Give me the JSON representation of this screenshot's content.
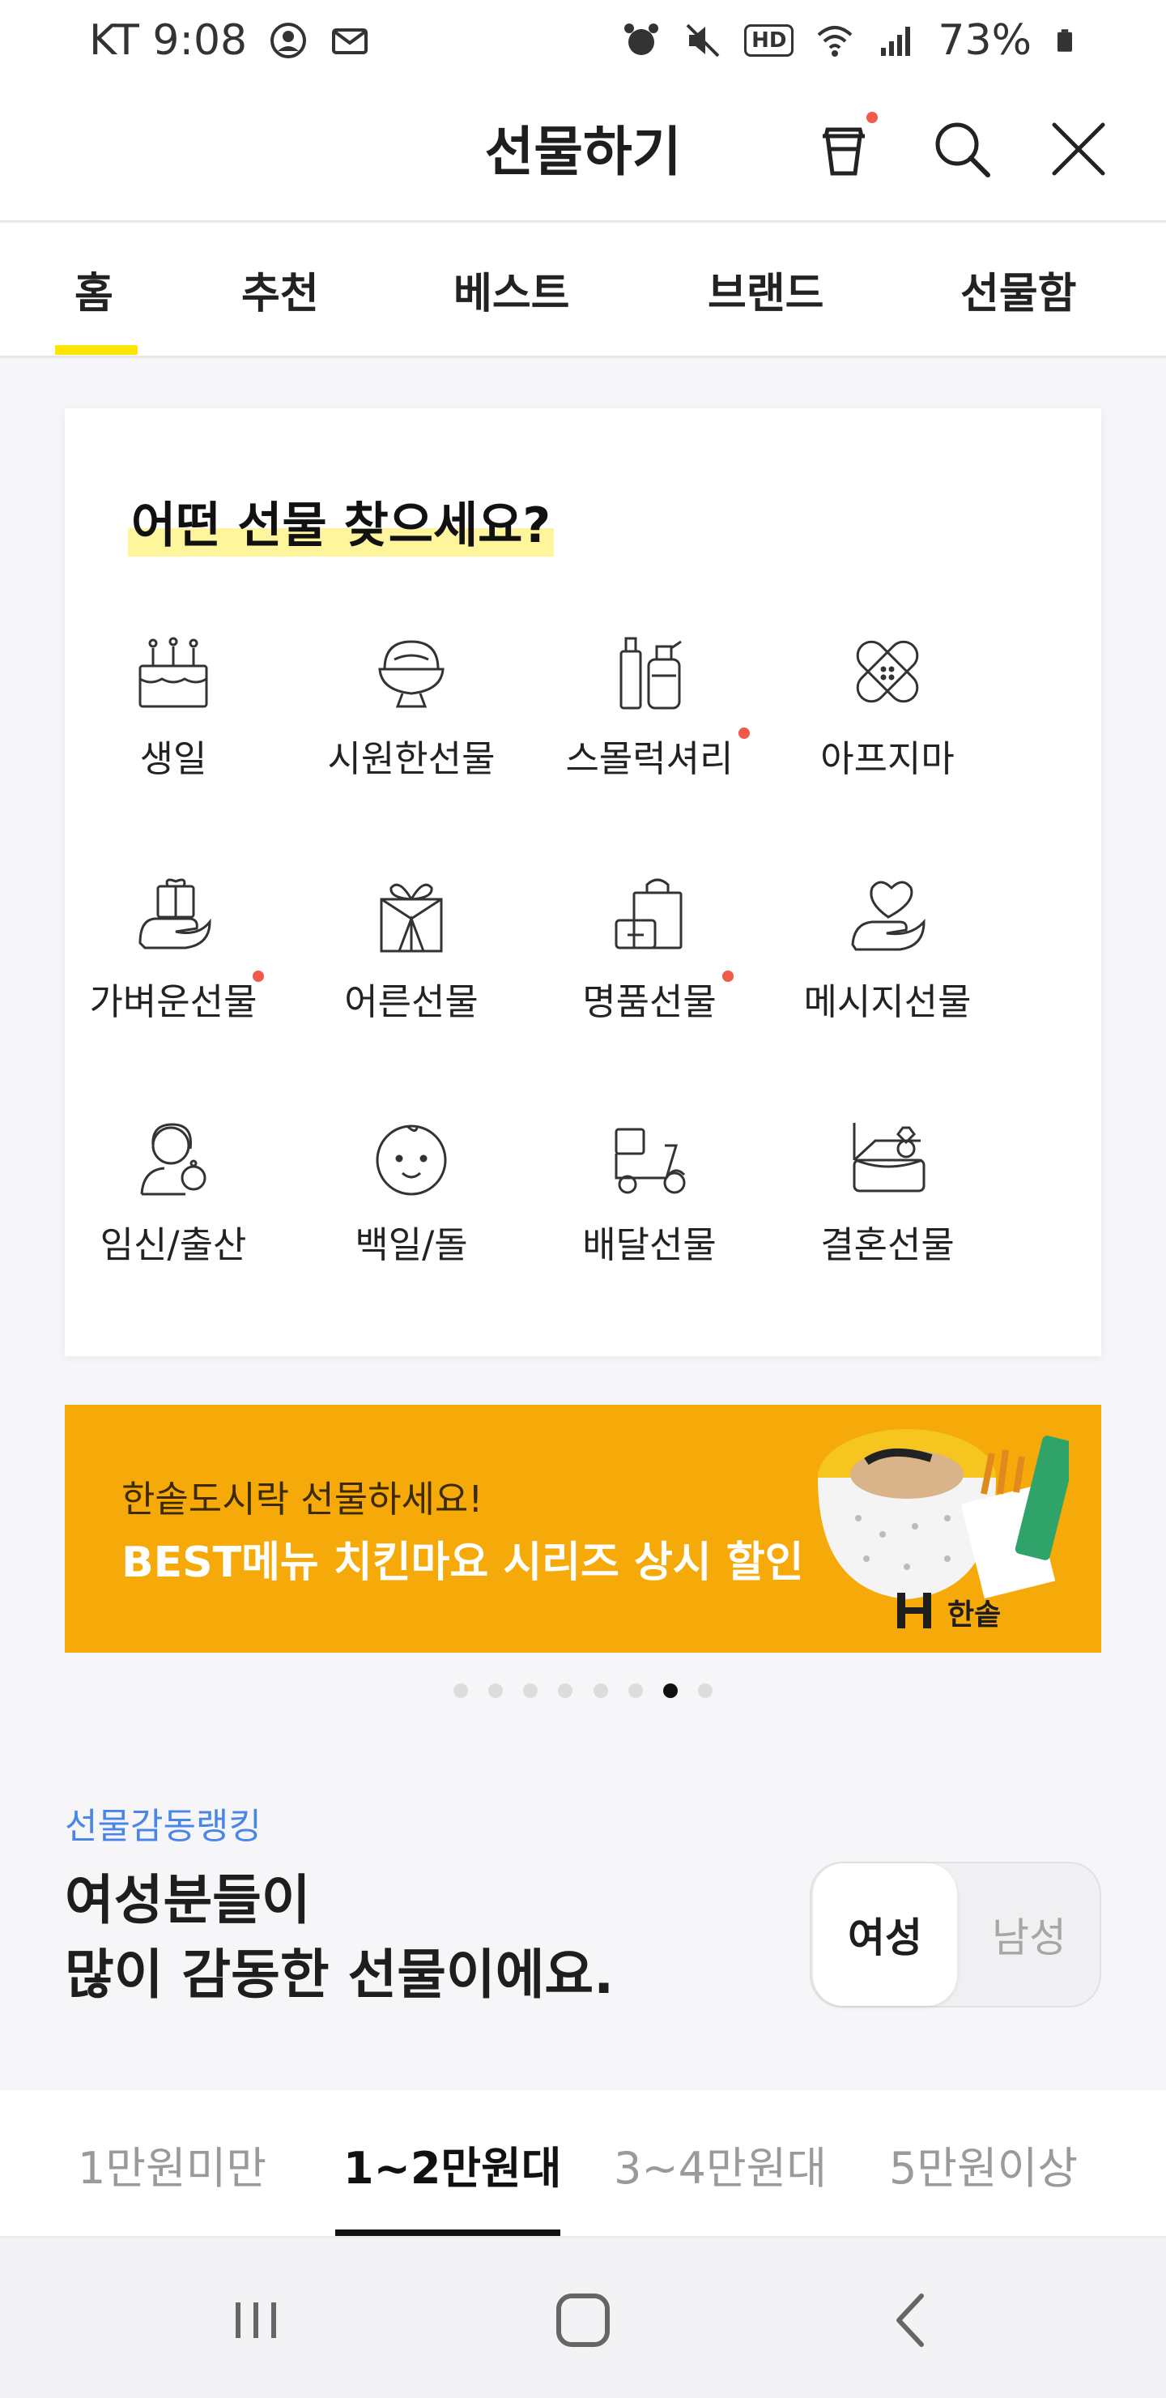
{
  "status_bar": {
    "carrier_time": "KT 9:08",
    "hd_label": "HD",
    "battery": "73%"
  },
  "header": {
    "title": "선물하기"
  },
  "main_tabs": [
    {
      "label": "홈"
    },
    {
      "label": "추천"
    },
    {
      "label": "베스트"
    },
    {
      "label": "브랜드"
    },
    {
      "label": "선물함"
    }
  ],
  "category_card": {
    "heading": "어떤 선물 찾으세요?",
    "items": [
      {
        "label": "생일",
        "icon": "birthday-cake-icon"
      },
      {
        "label": "시원한선물",
        "icon": "shaved-ice-icon"
      },
      {
        "label": "스몰럭셔리",
        "icon": "cosmetics-bottles-icon"
      },
      {
        "label": "아프지마",
        "icon": "bandage-icon"
      },
      {
        "label": "가벼운선물",
        "icon": "gift-in-hand-icon"
      },
      {
        "label": "어른선물",
        "icon": "wrapped-gift-icon"
      },
      {
        "label": "명품선물",
        "icon": "shopping-bag-icon"
      },
      {
        "label": "메시지선물",
        "icon": "heart-in-hand-icon"
      },
      {
        "label": "임신/출산",
        "icon": "mother-baby-icon"
      },
      {
        "label": "백일/돌",
        "icon": "baby-face-icon"
      },
      {
        "label": "배달선물",
        "icon": "delivery-scooter-icon"
      },
      {
        "label": "결혼선물",
        "icon": "ring-box-icon"
      }
    ]
  },
  "banner": {
    "line1": "한솥도시락 선물하세요!",
    "line2": "BEST메뉴 치킨마요 시리즈 상시 할인",
    "brand": "한솥"
  },
  "carousel": {
    "total": 8,
    "active_index": 6
  },
  "ranking": {
    "eyebrow": "선물감동랭킹",
    "title_line1": "여성분들이",
    "title_line2": "많이 감동한 선물이에요.",
    "gender_selected": "여성",
    "gender_other": "남성"
  },
  "price_tabs": [
    {
      "label": "1만원미만"
    },
    {
      "label": "1~2만원대"
    },
    {
      "label": "3~4만원대"
    },
    {
      "label": "5만원이상"
    }
  ],
  "price_tab_active": "1~2만원대",
  "colors": {
    "accent_yellow": "#fee500",
    "banner_orange": "#f5aa0a",
    "link_blue": "#4a86e8",
    "notification_red": "#f05a4a"
  }
}
